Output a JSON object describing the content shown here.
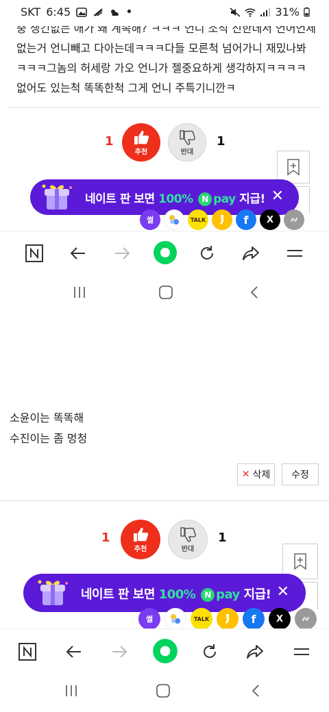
{
  "status_bar": {
    "carrier": "SKT",
    "time": "6:45",
    "battery": "31%",
    "icons_left": [
      "gallery-icon",
      "wifi-calling-icon",
      "weather-icon",
      "dot-icon"
    ],
    "icons_right": [
      "mute-icon",
      "wifi-icon",
      "signal-icon",
      "battery-icon"
    ]
  },
  "comment_1": {
    "lines": [
      "중 생긴없는 애가 왜 계속해? ㅋㅋㅋ 언니 소식 진한데서 언어언제",
      "없는거 언니빼고 다아는데ㅋㅋㅋ다들 모른척 넘어가니 재밌나봐",
      "ㅋㅋㅋ그놈의 허세랑 가오 언니가 젤중요하게 생각하지ㅋㅋㅋㅋ",
      "없어도 있는척 똑똑한척 그게 언니 주특기니깐ㅋ"
    ],
    "likes": "1",
    "dislikes": "1"
  },
  "vote": {
    "like_label": "추천",
    "dislike_label": "반대"
  },
  "banner": {
    "text_prefix": "네이트 판 보면 ",
    "percent": "100%",
    "npay_n": "N",
    "npay": "pay",
    "text_suffix": " 지급!",
    "close": "✕"
  },
  "share": {
    "ssul": "썰",
    "talk": "TALK",
    "facebook": "f",
    "x": "X"
  },
  "comment_2": {
    "lines": [
      "소윤이는 똑똑해",
      "수진이는 좀 멍청"
    ],
    "delete_label": "삭제",
    "edit_label": "수정",
    "likes": "1",
    "dislikes": "1"
  },
  "colors": {
    "like": "#ee2f1b",
    "banner": "#5b1ad8",
    "npay_green": "#2bd476",
    "accent_green": "#00d45c"
  }
}
